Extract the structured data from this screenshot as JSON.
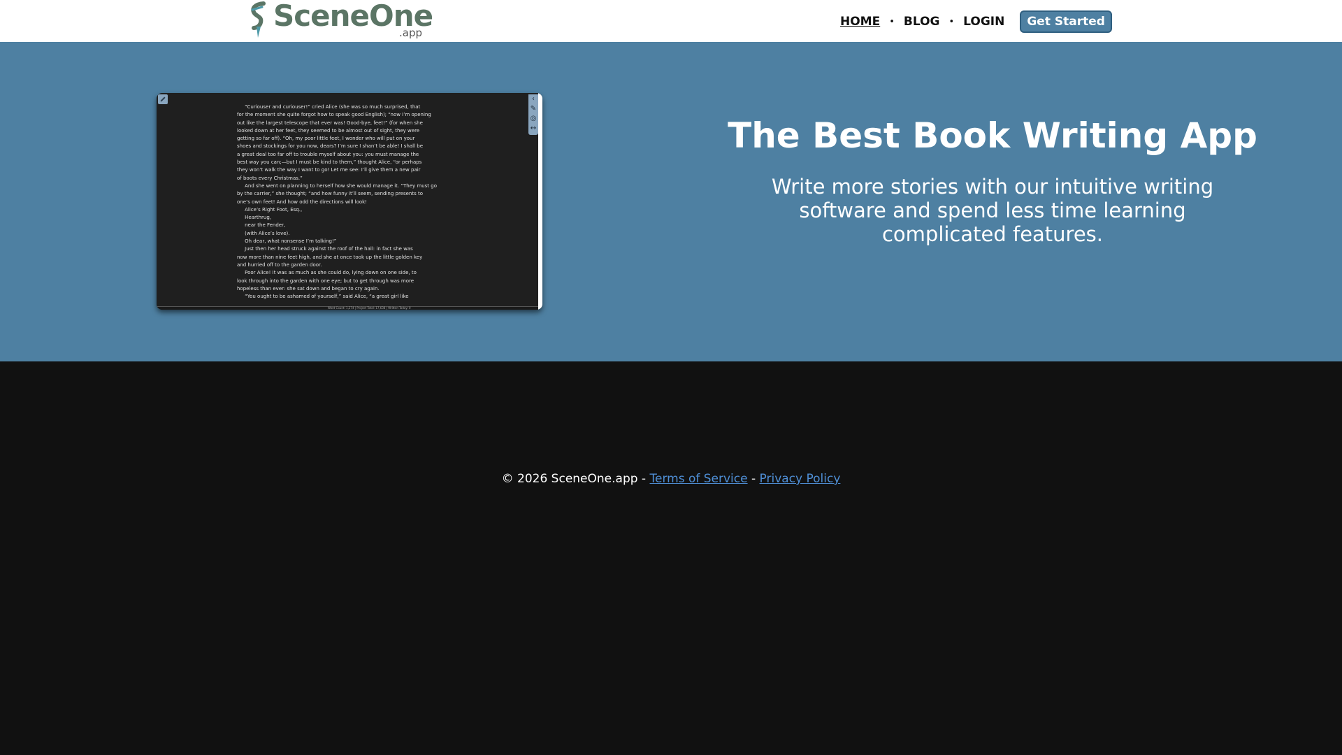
{
  "brand": {
    "name": "SceneOne",
    "suffix": ".app",
    "logo_icon": "quill-s-icon",
    "color": "#5b7565"
  },
  "nav": {
    "home": "HOME",
    "blog": "BLOG",
    "login": "LOGIN",
    "separator": "•",
    "cta": "Get Started"
  },
  "hero": {
    "title": "The Best Book Writing App",
    "subtitle": "Write more stories with our intuitive writing software and spend less time learning complicated features.",
    "background": "#4e80a2",
    "editor_preview": {
      "text": "     “Curiouser and curiouser!” cried Alice (she was so much surprised, that\nfor the moment she quite forgot how to speak good English); “now I’m opening\nout like the largest telescope that ever was! Good-bye, feet!” (for when she\nlooked down at her feet, they seemed to be almost out of sight, they were\ngetting so far off). “Oh, my poor little feet, I wonder who will put on your\nshoes and stockings for you now, dears? I’m sure I shan’t be able! I shall be\na great deal too far off to trouble myself about you: you must manage the\nbest way you can;—but I must be kind to them,” thought Alice, “or perhaps\nthey won’t walk the way I want to go! Let me see: I’ll give them a new pair\nof boots every Christmas.”\n     And she went on planning to herself how she would manage it. “They must go\nby the carrier,” she thought; “and how funny it’ll seem, sending presents to\none’s own feet! And how odd the directions will look!\n     Alice’s Right Foot, Esq.,\n     Hearthrug,\n     near the Fender,\n     (with Alice’s love).\n     Oh dear, what nonsense I’m talking!”\n     Just then her head struck against the roof of the hall: in fact she was\nnow more than nine feet high, and she at once took up the little golden key\nand hurried off to the garden door.\n     Poor Alice! It was as much as she could do, lying down on one side, to\nlook through into the garden with one eye; but to get through was more\nhopeless than ever: she sat down and began to cry again.\n     “You ought to be ashamed of yourself,” said Alice, “a great girl like",
      "status": "Word Count: 1,274 | Project Total: 17,638 | Written Today: 0"
    }
  },
  "footer": {
    "copyright": "© 2026 SceneOne.app - ",
    "terms": "Terms of Service",
    "dash": " - ",
    "privacy": "Privacy Policy"
  }
}
